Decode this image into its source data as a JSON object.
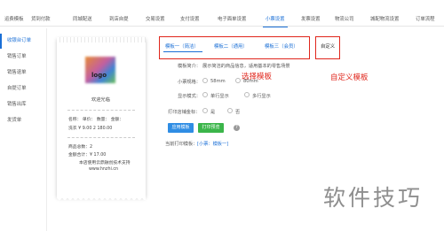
{
  "top_tabs": [
    "运费模板",
    "货到付款",
    "同城配送",
    "到店自提",
    "交易设置",
    "支付设置",
    "电子面单设置",
    "小票设置",
    "发票设置",
    "物流公司",
    "城配物流设置",
    "订单流程"
  ],
  "active_top_tab": "小票设置",
  "sidebar": [
    "收银台订单",
    "销售订单",
    "销售退单",
    "自提订单",
    "销售出库",
    "发货单"
  ],
  "receipt": {
    "logo": "logo",
    "welcome": "欢迎光临",
    "header_row": "名称：  单价：  数量：  金额：",
    "item_row": "洗衣     ¥ 9.00  2        180.00",
    "total_count": "商品总数：2",
    "total_amount": "金额合计：¥ 17.00",
    "support": "本店使用云鼎融创技术支持",
    "url": "www.hnzhi.cn"
  },
  "template_tabs": [
    "模板一（简洁）",
    "模板二（通用）",
    "模板三（会员）"
  ],
  "custom_tab": "自定义",
  "annotations": {
    "select_template": "选择模板",
    "custom_template": "自定义模板"
  },
  "settings": {
    "desc_label": "模板简介：",
    "desc_value": "展示简洁的商品信息，适用基本的零售场景",
    "width_label": "小票规格：",
    "width_options": [
      "58mm",
      "80mm"
    ],
    "display_label": "显示模式：",
    "display_options": [
      "单行显示",
      "多行显示"
    ],
    "print_qr_label": "打印店铺金标：",
    "print_qr_options": [
      "是",
      "否"
    ],
    "apply_button": "应用模板",
    "print_preview_button": "打印预览",
    "help_icon": "?",
    "current_label": "当前打印模板：",
    "current_value": "[小票：模板一]"
  },
  "watermark": "软件技巧"
}
